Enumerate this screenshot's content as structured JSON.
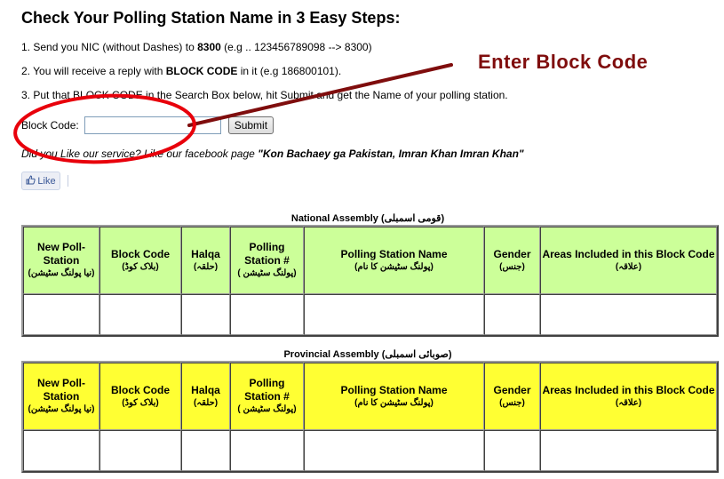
{
  "page": {
    "title": "Check Your Polling Station Name in 3 Easy Steps:"
  },
  "steps": {
    "step1_prefix": "1. Send you NIC (without Dashes) to ",
    "step1_bold": "8300",
    "step1_suffix": " (e.g .. 123456789098 --> 8300)",
    "step2_prefix": "2. You will receive a reply with ",
    "step2_bold": "BLOCK CODE",
    "step2_suffix": " in it (e.g 186800101).",
    "step3": "3. Put that BLOCK CODE in the Search Box below, hit Submit and get the Name of your polling station."
  },
  "form": {
    "label": "Block Code:",
    "input_value": "",
    "input_placeholder": "",
    "submit_label": "Submit"
  },
  "facebook": {
    "prompt_prefix": "Did you Like our service? Like our facebook page ",
    "page_name": "\"Kon Bachaey ga Pakistan, Imran Khan Imran Khan\"",
    "like_label": "Like",
    "like_icon": "thumbs-up-icon"
  },
  "annotation": {
    "label": "Enter Block Code",
    "color": "#7f0d0d",
    "circle_color": "#e8000b"
  },
  "national": {
    "caption": "National Assembly (قومی اسمبلی)",
    "header_color": "#ccff99",
    "columns": [
      {
        "en": "New Poll-Station",
        "ur": "(نیا پولنگ سٹیشن)"
      },
      {
        "en": "Block Code",
        "ur": "(بلاک کوڈ)"
      },
      {
        "en": "Halqa",
        "ur": "(حلقہ)"
      },
      {
        "en": "Polling Station #",
        "ur": "( پولنگ سٹیشن)"
      },
      {
        "en": "Polling Station Name",
        "ur": "(پولنگ سٹیشن کا نام)"
      },
      {
        "en": "Gender",
        "ur": "(جنس)"
      },
      {
        "en": "Areas Included in this Block Code",
        "ur": "(علاقہ)"
      }
    ],
    "rows": [
      [
        "",
        "",
        "",
        "",
        "",
        "",
        ""
      ]
    ]
  },
  "provincial": {
    "caption": "Provincial Assembly (صوبائی اسمبلی)",
    "header_color": "#ffff33",
    "columns": [
      {
        "en": "New Poll-Station",
        "ur": "(نیا پولنگ سٹیشن)"
      },
      {
        "en": "Block Code",
        "ur": "(بلاک کوڈ)"
      },
      {
        "en": "Halqa",
        "ur": "(حلقہ)"
      },
      {
        "en": "Polling Station #",
        "ur": "( پولنگ سٹیشن)"
      },
      {
        "en": "Polling Station Name",
        "ur": "(پولنگ سٹیشن کا نام)"
      },
      {
        "en": "Gender",
        "ur": "(جنس)"
      },
      {
        "en": "Areas Included in this Block Code",
        "ur": "(علاقہ)"
      }
    ],
    "rows": [
      [
        "",
        "",
        "",
        "",
        "",
        "",
        ""
      ]
    ]
  }
}
